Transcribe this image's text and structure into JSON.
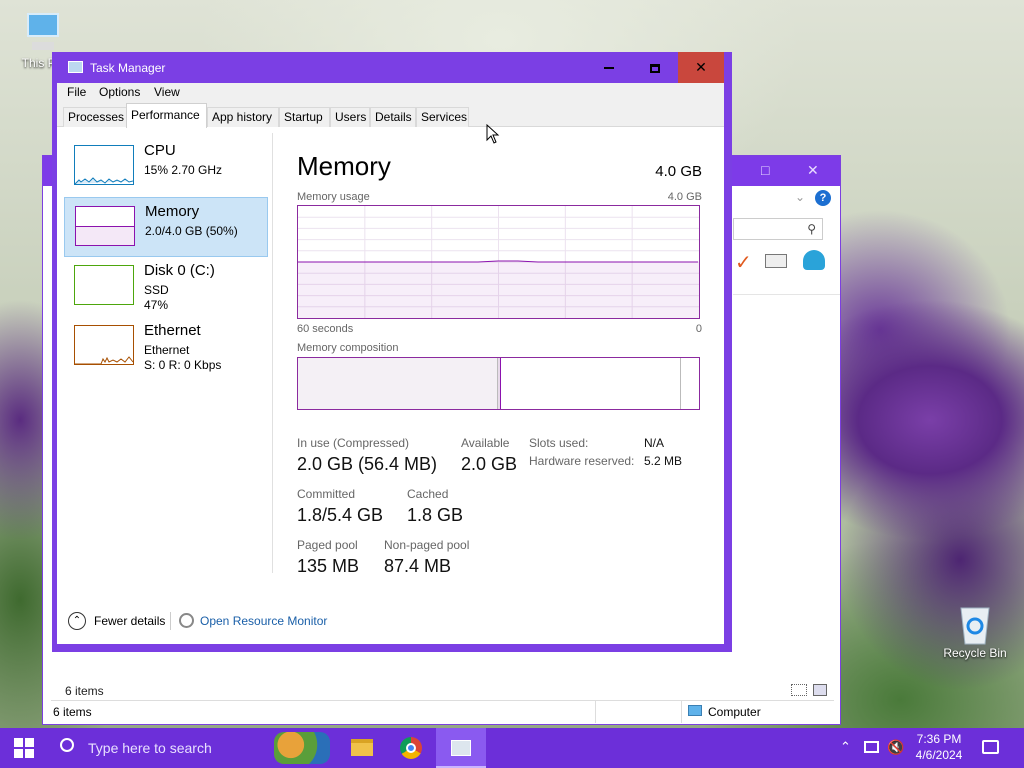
{
  "desktop": {
    "this_pc_label": "This PC",
    "recycle_bin_label": "Recycle Bin"
  },
  "explorer": {
    "status_items_top": "6 items",
    "status_items_bottom": "6 items",
    "status_location": "Computer"
  },
  "task_manager": {
    "title": "Task Manager",
    "menu": [
      "File",
      "Options",
      "View"
    ],
    "tabs": [
      "Processes",
      "Performance",
      "App history",
      "Startup",
      "Users",
      "Details",
      "Services"
    ],
    "active_tab": "Performance",
    "sidebar": [
      {
        "name": "CPU",
        "line1": "15% 2.70 GHz",
        "line2": "",
        "color": "#117dbb"
      },
      {
        "name": "Memory",
        "line1": "2.0/4.0 GB (50%)",
        "line2": "",
        "color": "#8b12ae"
      },
      {
        "name": "Disk 0 (C:)",
        "line1": "SSD",
        "line2": "47%",
        "color": "#4da60c"
      },
      {
        "name": "Ethernet",
        "line1": "Ethernet",
        "line2": "S: 0 R: 0 Kbps",
        "color": "#a74f01"
      }
    ],
    "memory": {
      "title": "Memory",
      "total": "4.0 GB",
      "usage_label": "Memory usage",
      "usage_max": "4.0 GB",
      "time_left": "60 seconds",
      "time_right": "0",
      "composition_label": "Memory composition",
      "usage_level": 0.5,
      "stats": {
        "in_use_label": "In use (Compressed)",
        "in_use_value": "2.0 GB (56.4 MB)",
        "available_label": "Available",
        "available_value": "2.0 GB",
        "slots_label": "Slots used:",
        "slots_value": "N/A",
        "hw_reserved_label": "Hardware reserved:",
        "hw_reserved_value": "5.2 MB",
        "committed_label": "Committed",
        "committed_value": "1.8/5.4 GB",
        "cached_label": "Cached",
        "cached_value": "1.8 GB",
        "paged_label": "Paged pool",
        "paged_value": "135 MB",
        "nonpaged_label": "Non-paged pool",
        "nonpaged_value": "87.4 MB"
      }
    },
    "footer": {
      "fewer_details": "Fewer details",
      "open_resource_monitor": "Open Resource Monitor"
    }
  },
  "taskbar": {
    "search_placeholder": "Type here to search",
    "time": "7:36 PM",
    "date": "4/6/2024"
  },
  "colors": {
    "accent": "#7b3fe4",
    "taskbar": "#6c2fd9",
    "close_button": "#c9473d",
    "memory_graph": "#8b12ae",
    "link": "#1a5fa8"
  }
}
